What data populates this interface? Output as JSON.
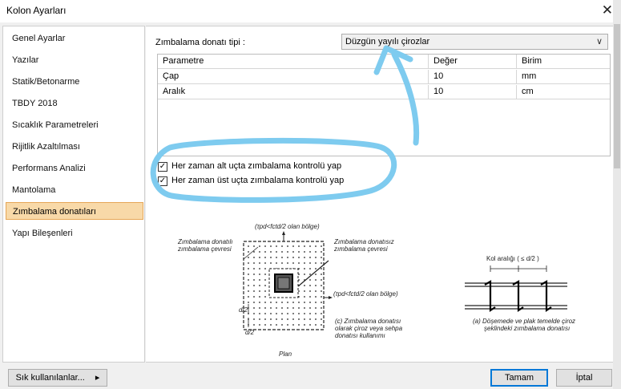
{
  "window": {
    "title": "Kolon Ayarları",
    "close_icon": "✕"
  },
  "sidebar": {
    "items": [
      {
        "label": "Genel Ayarlar"
      },
      {
        "label": "Yazılar"
      },
      {
        "label": "Statik/Betonarme"
      },
      {
        "label": "TBDY 2018"
      },
      {
        "label": "Sıcaklık Parametreleri"
      },
      {
        "label": "Rijitlik Azaltılması"
      },
      {
        "label": "Performans Analizi"
      },
      {
        "label": "Mantolama"
      },
      {
        "label": "Zımbalama donatıları",
        "selected": true
      },
      {
        "label": "Yapı Bileşenleri"
      }
    ]
  },
  "main": {
    "type_label": "Zımbalama donatı tipi :",
    "type_value": "Düzgün yayılı çirozlar",
    "grid": {
      "columns": [
        "Parametre",
        "Değer",
        "Birim"
      ],
      "rows": [
        [
          "Çap",
          "10",
          "mm"
        ],
        [
          "Aralık",
          "10",
          "cm"
        ]
      ]
    },
    "checkboxes": [
      {
        "label": "Her zaman alt uçta zımbalama kontrolü yap",
        "checked": true,
        "mark": "✓"
      },
      {
        "label": "Her zaman üst uçta zımbalama kontrolü yap",
        "checked": true,
        "mark": "✓"
      }
    ],
    "figure": {
      "top_note": "(τpd<fctd/2 olan bölge)",
      "left_note_1": "Zımbalama donatılı",
      "left_note_2": "zımbalama çevresi",
      "right_note_1": "Zımbalama donatısız",
      "right_note_2": "zımbalama çevresi",
      "right_zone": "(τpd<fctd/2 olan bölge)",
      "dim_1": "d/2",
      "dim_2": "d/2",
      "caption_c_1": "(c) Zımbalama donatısı",
      "caption_c_2": "olarak çiroz veya sehpa",
      "caption_c_3": "donatısı kullanımı",
      "plan": "Plan",
      "col_spacing": "Kol aralığı ( ≤ d/2 )",
      "caption_a_1": "(a) Döşemede ve plak temelde çiroz",
      "caption_a_2": "şeklindeki zımbalama donatısı"
    }
  },
  "footer": {
    "favorites_label": "Sık kullanılanlar...",
    "favorites_arrow": "▸",
    "ok_label": "Tamam",
    "cancel_label": "İptal"
  },
  "colors": {
    "selection_bg": "#f8d9a8",
    "selection_border": "#e6a656",
    "annotation": "#7ecbef",
    "primary_border": "#0078d7"
  }
}
